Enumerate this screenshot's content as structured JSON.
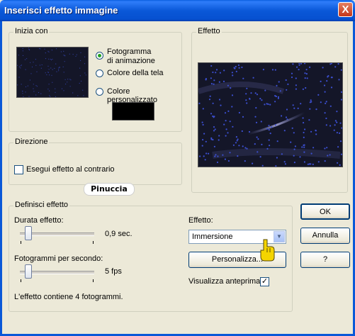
{
  "window": {
    "title": "Inserisci effetto immagine",
    "close_glyph": "X"
  },
  "start_group": {
    "legend": "Inizia con",
    "options": [
      {
        "line1": "Fotogramma",
        "line2": "di animazione",
        "selected": true
      },
      {
        "label": "Colore della tela",
        "selected": false
      },
      {
        "label": "Colore personalizzato",
        "selected": false
      }
    ],
    "custom_color": "#000000"
  },
  "direction_group": {
    "legend": "Direzione",
    "reverse_label": "Esegui effetto al contrario",
    "reverse_checked": false
  },
  "watermark": "Pinuccia",
  "effect_preview": {
    "legend": "Effetto"
  },
  "define_group": {
    "legend": "Definisci effetto",
    "duration_label": "Durata effetto:",
    "duration_value": "0,9 sec.",
    "fps_label": "Fotogrammi per secondo:",
    "fps_value": "5 fps",
    "summary": "L'effetto contiene 4 fotogrammi.",
    "effect_label": "Effetto:",
    "effect_selected": "Immersione",
    "customize_label": "Personalizza...",
    "preview_label": "Visualizza anteprima",
    "preview_checked": true,
    "check_glyph": "✓",
    "dropdown_glyph": "▼"
  },
  "buttons": {
    "ok": "OK",
    "cancel": "Annulla",
    "help": "?"
  },
  "colors": {
    "title_bar": "#0a58d8",
    "face": "#ece9d8",
    "preview_bg": "#141628",
    "dots": "#3c4fd0"
  }
}
